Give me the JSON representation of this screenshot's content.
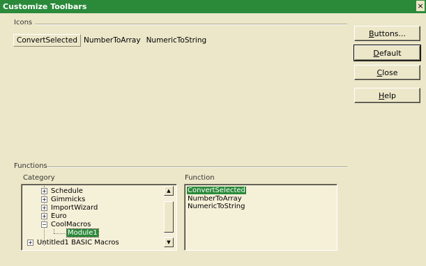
{
  "window": {
    "title": "Customize Toolbars",
    "close_glyph": "×"
  },
  "icons": {
    "group_label": "Icons",
    "tabs": [
      "ConvertSelected",
      "NumberToArray",
      "NumericToString"
    ],
    "selected_tab": 0
  },
  "buttons": {
    "buttons_label": "Buttons...",
    "buttons_mn": "B",
    "buttons_rest": "uttons...",
    "default_mn": "D",
    "default_rest": "efault",
    "close_mn": "C",
    "close_rest": "lose",
    "help_mn": "H",
    "help_rest": "elp"
  },
  "functions": {
    "group_label": "Functions",
    "category_label": "Category",
    "function_label": "Function",
    "category_items": [
      {
        "label": "Schedule",
        "expander": "+"
      },
      {
        "label": "Gimmicks",
        "expander": "+"
      },
      {
        "label": "ImportWizard",
        "expander": "+"
      },
      {
        "label": "Euro",
        "expander": "+"
      },
      {
        "label": "CoolMacros",
        "expander": "−"
      },
      {
        "label": "Module1",
        "expander": ""
      },
      {
        "label": "Untitled1 BASIC Macros",
        "expander": "+"
      }
    ],
    "selected_category": "Module1",
    "function_items": [
      "ConvertSelected",
      "NumberToArray",
      "NumericToString"
    ],
    "selected_function": "ConvertSelected"
  },
  "scrollbar": {
    "up_glyph": "▲",
    "down_glyph": "▼"
  }
}
